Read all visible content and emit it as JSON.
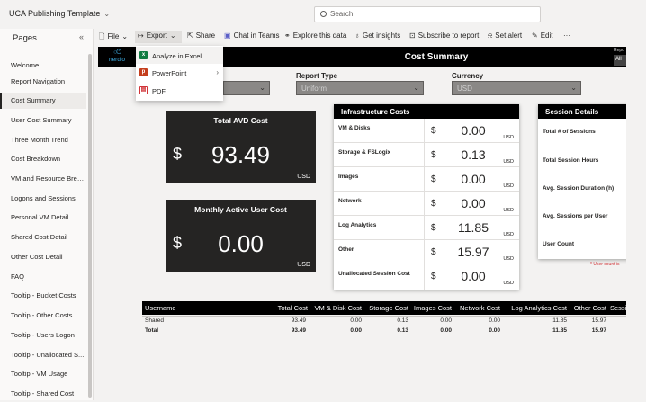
{
  "app": {
    "title": "UCA Publishing Template"
  },
  "search": {
    "placeholder": "Search"
  },
  "sidebar": {
    "title": "Pages",
    "items": [
      {
        "label": "Welcome"
      },
      {
        "label": "Report Navigation"
      },
      {
        "label": "Cost Summary",
        "active": true
      },
      {
        "label": "User Cost Summary"
      },
      {
        "label": "Three Month Trend"
      },
      {
        "label": "Cost Breakdown"
      },
      {
        "label": "VM and Resource Brea..."
      },
      {
        "label": "Logons and Sessions"
      },
      {
        "label": "Personal VM Detail"
      },
      {
        "label": "Shared Cost Detail"
      },
      {
        "label": "Other Cost Detail"
      },
      {
        "label": "FAQ"
      },
      {
        "label": "Tooltip - Bucket Costs"
      },
      {
        "label": "Tooltip - Other Costs"
      },
      {
        "label": "Tooltip - Users Logon"
      },
      {
        "label": "Tooltip - Unallocated S..."
      },
      {
        "label": "Tooltip - VM Usage"
      },
      {
        "label": "Tooltip - Shared Cost"
      }
    ]
  },
  "toolbar": {
    "file": "File",
    "export": "Export",
    "share": "Share",
    "chat": "Chat in Teams",
    "explore": "Explore this data",
    "insights": "Get insights",
    "subscribe": "Subscribe to report",
    "alert": "Set alert",
    "edit": "Edit",
    "more": "···"
  },
  "export_menu": {
    "items": [
      {
        "label": "Analyze in Excel",
        "icon": "excel-icon"
      },
      {
        "label": "PowerPoint",
        "icon": "powerpoint-icon"
      },
      {
        "label": "PDF",
        "icon": "pdf-icon"
      }
    ]
  },
  "report": {
    "logo_text": "nerdio",
    "title": "Cost Summary",
    "header_right_label": "Repo",
    "header_right_button": "All"
  },
  "filters": {
    "report_type": {
      "label": "Report Type",
      "value": "Uniform"
    },
    "currency": {
      "label": "Currency",
      "value": "USD"
    }
  },
  "kpis": {
    "avd": {
      "title": "Total AVD Cost",
      "symbol": "$",
      "value": "93.49",
      "unit": "USD"
    },
    "mau": {
      "title": "Monthly Active User Cost",
      "symbol": "$",
      "value": "0.00",
      "unit": "USD"
    }
  },
  "infrastructure": {
    "title": "Infrastructure Costs",
    "rows": [
      {
        "label": "VM & Disks",
        "symbol": "$",
        "value": "0.00",
        "unit": "USD"
      },
      {
        "label": "Storage & FSLogix",
        "symbol": "$",
        "value": "0.13",
        "unit": "USD"
      },
      {
        "label": "Images",
        "symbol": "$",
        "value": "0.00",
        "unit": "USD"
      },
      {
        "label": "Network",
        "symbol": "$",
        "value": "0.00",
        "unit": "USD"
      },
      {
        "label": "Log Analytics",
        "symbol": "$",
        "value": "11.85",
        "unit": "USD"
      },
      {
        "label": "Other",
        "symbol": "$",
        "value": "15.97",
        "unit": "USD"
      },
      {
        "label": "Unallocated Session Cost",
        "symbol": "$",
        "value": "0.00",
        "unit": "USD"
      }
    ]
  },
  "session": {
    "title": "Session Details",
    "rows": [
      {
        "label": "Total # of Sessions"
      },
      {
        "label": "Total Session Hours"
      },
      {
        "label": "Avg. Session Duration (h)"
      },
      {
        "label": "Avg. Sessions per User"
      },
      {
        "label": "User Count"
      }
    ],
    "note": "* User count is"
  },
  "table": {
    "headers": [
      "Username",
      "Total Cost",
      "VM & Disk Cost",
      "Storage Cost",
      "Images Cost",
      "Network Cost",
      "Log Analytics Cost",
      "Other Cost",
      "Sessio"
    ],
    "rows": [
      [
        "Shared",
        "93.49",
        "0.00",
        "0.13",
        "0.00",
        "0.00",
        "11.85",
        "15.97"
      ],
      [
        "Total",
        "93.49",
        "0.00",
        "0.13",
        "0.00",
        "0.00",
        "11.85",
        "15.97"
      ]
    ]
  }
}
